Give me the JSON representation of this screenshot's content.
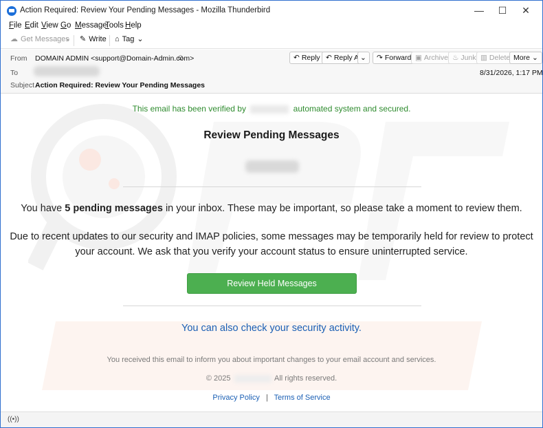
{
  "window": {
    "title": "Action Required: Review Your Pending Messages - Mozilla Thunderbird",
    "minimize": "—",
    "maximize": "☐",
    "close": "✕"
  },
  "menu": {
    "items": [
      "File",
      "Edit",
      "View",
      "Go",
      "Message",
      "Tools",
      "Help"
    ],
    "accelerators": [
      "F",
      "E",
      "V",
      "G",
      "M",
      "T",
      "H"
    ]
  },
  "toolbar": {
    "get_messages": "Get Messages",
    "write": "Write",
    "tag": "Tag"
  },
  "header": {
    "from_label": "From",
    "from_value": "DOMAIN ADMIN <support@Domain-Admin.com>",
    "to_label": "To",
    "subject_label": "Subject",
    "subject_value": "Action Required: Review Your Pending Messages",
    "date": "8/31/2026, 1:17 PM",
    "buttons": {
      "reply": "Reply",
      "reply_all": "Reply All",
      "forward": "Forward",
      "archive": "Archive",
      "junk": "Junk",
      "delete": "Delete",
      "more": "More"
    }
  },
  "email": {
    "verified_prefix": "This email has been verified by",
    "verified_suffix": "automated system and secured.",
    "headline": "Review Pending Messages",
    "pending_prefix": "You have",
    "pending_count": "5 pending messages",
    "pending_suffix": "in your inbox. These may be important, so please take a moment to review them.",
    "policy_text": "Due to recent updates to our security and IMAP policies, some messages may be temporarily held for review to protect your account. We ask that you verify your account status to ensure uninterrupted service.",
    "cta_label": "Review Held Messages",
    "security_link": "You can also check your security activity.",
    "footer_note": "You received this email to inform you about important changes to your email account and services.",
    "copyright_prefix": "© 2025",
    "copyright_suffix": "All rights reserved.",
    "privacy_link": "Privacy Policy",
    "separator": "|",
    "terms_link": "Terms of Service"
  },
  "colors": {
    "accent_green": "#4caf50",
    "verified_green": "#2e8b2e",
    "link_blue": "#1a5fb4",
    "window_border": "#2f6fcf"
  },
  "icons": {
    "app": "thunderbird-logo-icon",
    "status": "connection-status-icon"
  }
}
